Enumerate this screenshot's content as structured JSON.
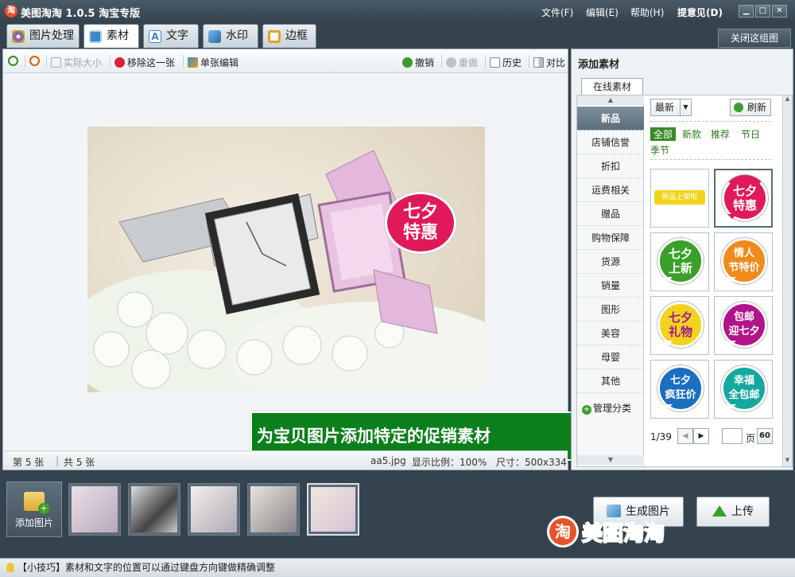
{
  "window": {
    "title": "美图淘淘 1.0.5 淘宝专版",
    "menu": [
      "文件(F)",
      "编辑(E)",
      "帮助(H)",
      "提意见(D)"
    ],
    "controls": [
      "▁",
      "□",
      "✕"
    ]
  },
  "tabs": [
    {
      "label": "图片处理",
      "icon": "palette-icon",
      "color": "#d04a8a"
    },
    {
      "label": "素材",
      "icon": "sticker-icon",
      "color": "#3a88c8"
    },
    {
      "label": "文字",
      "icon": "text-icon",
      "color": "#3a88c8"
    },
    {
      "label": "水印",
      "icon": "watermark-icon",
      "color": "#3a88c8"
    },
    {
      "label": "边框",
      "icon": "frame-icon",
      "color": "#e8a020"
    }
  ],
  "close_group": "关闭这组图",
  "toolbar": {
    "actual_size": "实际大小",
    "remove_one": "移除这一张",
    "single_edit": "单张编辑",
    "undo": "撤销",
    "redo": "重做",
    "history": "历史",
    "compare": "对比"
  },
  "canvas": {
    "promo_text": "为宝贝图片添加特定的促销素材",
    "sticker_text": "七夕\n特惠"
  },
  "status": {
    "current": "第 5 张",
    "total": "共 5 张",
    "filename": "aa5.jpg",
    "zoom": "显示比例：100%",
    "size": "尺寸：500x334"
  },
  "panel": {
    "title": "添加素材",
    "tab": "在线素材",
    "categories": [
      "新品",
      "店铺信誉",
      "折扣",
      "运费相关",
      "赠品",
      "购物保障",
      "货源",
      "销量",
      "图形",
      "美容",
      "母婴",
      "其他"
    ],
    "manage": "管理分类",
    "sort": "最新",
    "refresh": "刷新",
    "filters": [
      "全部",
      "新款",
      "推荐",
      "节日",
      "季节"
    ],
    "stickers": [
      {
        "text": "新品上架啦",
        "color": "#f2c434"
      },
      {
        "text": "七夕特惠",
        "color": "#e01a5a"
      },
      {
        "text": "七夕上新",
        "color": "#3aa02a"
      },
      {
        "text": "情人节特价",
        "color": "#f08a1c"
      },
      {
        "text": "七夕礼物",
        "color": "#f2d21c"
      },
      {
        "text": "包邮迎七夕",
        "color": "#b0148a"
      },
      {
        "text": "七夕疯狂价",
        "color": "#1a6fc0"
      },
      {
        "text": "幸福全包邮",
        "color": "#14a8a0"
      }
    ],
    "page": "1/39",
    "page_unit": "页",
    "go": "60"
  },
  "bottom": {
    "add_image": "添加图片",
    "generate": "生成图片",
    "upload": "上传",
    "logo_text": "美图淘淘",
    "logo_char": "淘"
  },
  "tip": "【小技巧】素材和文字的位置可以通过键盘方向键做精确调整"
}
